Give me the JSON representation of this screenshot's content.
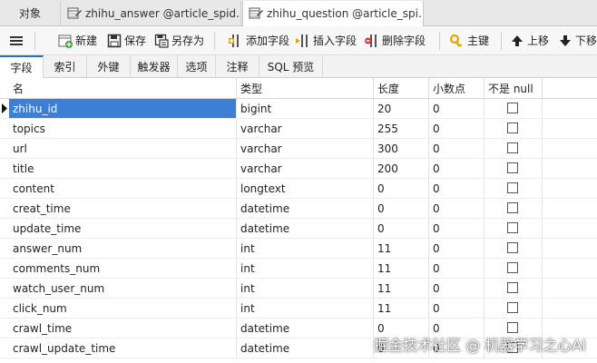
{
  "tabs": [
    {
      "label": "对象"
    },
    {
      "label": "zhihu_answer @article_spid..."
    },
    {
      "label": "zhihu_question @article_spi..."
    }
  ],
  "toolbar": {
    "new_label": "新建",
    "save_label": "保存",
    "save_as_label": "另存为",
    "add_field_label": "添加字段",
    "insert_field_label": "插入字段",
    "delete_field_label": "删除字段",
    "primary_key_label": "主键",
    "move_up_label": "上移",
    "move_down_label": "下移"
  },
  "subtabs": [
    "字段",
    "索引",
    "外键",
    "触发器",
    "选项",
    "注释",
    "SQL 预览"
  ],
  "table": {
    "columns": [
      "名",
      "类型",
      "长度",
      "小数点",
      "不是 null"
    ],
    "rows": [
      {
        "name": "zhihu_id",
        "type": "bigint",
        "length": "20",
        "decimals": "0",
        "not_null": false
      },
      {
        "name": "topics",
        "type": "varchar",
        "length": "255",
        "decimals": "0",
        "not_null": false
      },
      {
        "name": "url",
        "type": "varchar",
        "length": "300",
        "decimals": "0",
        "not_null": false
      },
      {
        "name": "title",
        "type": "varchar",
        "length": "200",
        "decimals": "0",
        "not_null": false
      },
      {
        "name": "content",
        "type": "longtext",
        "length": "0",
        "decimals": "0",
        "not_null": false
      },
      {
        "name": "creat_time",
        "type": "datetime",
        "length": "0",
        "decimals": "0",
        "not_null": false
      },
      {
        "name": "update_time",
        "type": "datetime",
        "length": "0",
        "decimals": "0",
        "not_null": false
      },
      {
        "name": "answer_num",
        "type": "int",
        "length": "11",
        "decimals": "0",
        "not_null": false
      },
      {
        "name": "comments_num",
        "type": "int",
        "length": "11",
        "decimals": "0",
        "not_null": false
      },
      {
        "name": "watch_user_num",
        "type": "int",
        "length": "11",
        "decimals": "0",
        "not_null": false
      },
      {
        "name": "click_num",
        "type": "int",
        "length": "11",
        "decimals": "0",
        "not_null": false
      },
      {
        "name": "crawl_time",
        "type": "datetime",
        "length": "0",
        "decimals": "0",
        "not_null": false
      },
      {
        "name": "crawl_update_time",
        "type": "datetime",
        "length": "0",
        "decimals": "0",
        "not_null": false
      }
    ]
  },
  "watermark": "掘金技术社区 @ 机器学习之心AI",
  "colors": {
    "selection": "#3c7fd4",
    "active_tab_accent": "#2f6fbd"
  }
}
